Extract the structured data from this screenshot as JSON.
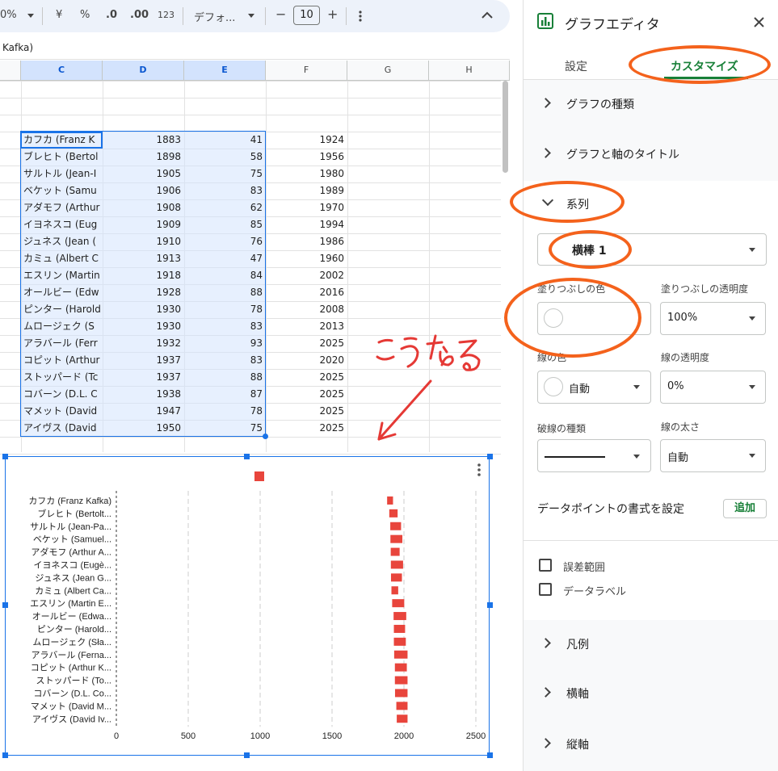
{
  "toolbar": {
    "zoom_percent": "0%",
    "currency": "¥",
    "percent": "%",
    "decrease_decimals": ".0",
    "increase_decimals": ".00",
    "number_format": "123",
    "font_select": "デフォ...",
    "font_size": "10",
    "minus": "−",
    "plus": "+"
  },
  "formula_bar": {
    "text": "Kafka)"
  },
  "columns": [
    "C",
    "D",
    "E",
    "F",
    "G",
    "H"
  ],
  "rows": [
    {
      "name": "カフカ (Franz K",
      "d": "1883",
      "e": "41",
      "f": "1924"
    },
    {
      "name": "ブレヒト (Bertol",
      "d": "1898",
      "e": "58",
      "f": "1956"
    },
    {
      "name": "サルトル (Jean-I",
      "d": "1905",
      "e": "75",
      "f": "1980"
    },
    {
      "name": "ベケット (Samu",
      "d": "1906",
      "e": "83",
      "f": "1989"
    },
    {
      "name": "アダモフ (Arthur",
      "d": "1908",
      "e": "62",
      "f": "1970"
    },
    {
      "name": "イヨネスコ (Eug",
      "d": "1909",
      "e": "85",
      "f": "1994"
    },
    {
      "name": "ジュネス (Jean (",
      "d": "1910",
      "e": "76",
      "f": "1986"
    },
    {
      "name": "カミュ (Albert C",
      "d": "1913",
      "e": "47",
      "f": "1960"
    },
    {
      "name": "エスリン (Martin",
      "d": "1918",
      "e": "84",
      "f": "2002"
    },
    {
      "name": "オールビー (Edw",
      "d": "1928",
      "e": "88",
      "f": "2016"
    },
    {
      "name": "ピンター (Harold",
      "d": "1930",
      "e": "78",
      "f": "2008"
    },
    {
      "name": "ムロージェク (S",
      "d": "1930",
      "e": "83",
      "f": "2013"
    },
    {
      "name": "アラバール (Ferr",
      "d": "1932",
      "e": "93",
      "f": "2025"
    },
    {
      "name": "コピット (Arthur",
      "d": "1937",
      "e": "83",
      "f": "2020"
    },
    {
      "name": "ストッパード (Tc",
      "d": "1937",
      "e": "88",
      "f": "2025"
    },
    {
      "name": "コバーン (D.L. C",
      "d": "1938",
      "e": "87",
      "f": "2025"
    },
    {
      "name": "マメット (David",
      "d": "1947",
      "e": "78",
      "f": "2025"
    },
    {
      "name": "アイヴス (David",
      "d": "1950",
      "e": "75",
      "f": "2025"
    }
  ],
  "annotation": {
    "handwritten": "こうなる"
  },
  "chart_data": {
    "type": "bar",
    "orientation": "horizontal",
    "categories": [
      "カフカ (Franz Kafka)",
      "ブレヒト (Bertolt...",
      "サルトル (Jean-Pa...",
      "ベケット (Samuel...",
      "アダモフ (Arthur A...",
      "イヨネスコ (Eugè...",
      "ジュネス (Jean G...",
      "カミュ (Albert Ca...",
      "エスリン (Martin E...",
      "オールビー (Edwa...",
      "ピンター (Harold...",
      "ムロージェク (Sła...",
      "アラバール (Ferna...",
      "コピット (Arthur K...",
      "ストッパード (To...",
      "コバーン (D.L. Co...",
      "マメット (David M...",
      "アイヴス (David Iv..."
    ],
    "series": [
      {
        "color": "#e8453c",
        "start": [
          1883,
          1898,
          1905,
          1906,
          1908,
          1909,
          1910,
          1913,
          1918,
          1928,
          1930,
          1930,
          1932,
          1937,
          1937,
          1938,
          1947,
          1950
        ],
        "end": [
          1924,
          1956,
          1980,
          1989,
          1970,
          1994,
          1986,
          1960,
          2002,
          2016,
          2008,
          2013,
          2025,
          2020,
          2025,
          2025,
          2025,
          2025
        ]
      }
    ],
    "xticks": [
      "0",
      "500",
      "1000",
      "1500",
      "2000",
      "2500"
    ],
    "xlim": [
      0,
      2500
    ],
    "grid": true,
    "legend": "top"
  },
  "panel": {
    "title": "グラフエディタ",
    "tab_setup": "設定",
    "tab_customize": "カスタマイズ",
    "sections": {
      "chart_type": "グラフの種類",
      "titles": "グラフと軸のタイトル",
      "series": "系列",
      "legend": "凡例",
      "h_axis": "横軸",
      "v_axis": "縦軸"
    },
    "series_select": "横棒 1",
    "fill_color_label": "塗りつぶしの色",
    "fill_opacity_label": "塗りつぶしの透明度",
    "fill_opacity_value": "100%",
    "line_color_label": "線の色",
    "line_color_value": "自動",
    "line_opacity_label": "線の透明度",
    "line_opacity_value": "0%",
    "dash_type_label": "破線の種類",
    "line_width_label": "線の太さ",
    "line_width_value": "自動",
    "data_point_label": "データポイントの書式を設定",
    "add_button": "追加",
    "error_bars": "誤差範囲",
    "data_labels": "データラベル"
  }
}
